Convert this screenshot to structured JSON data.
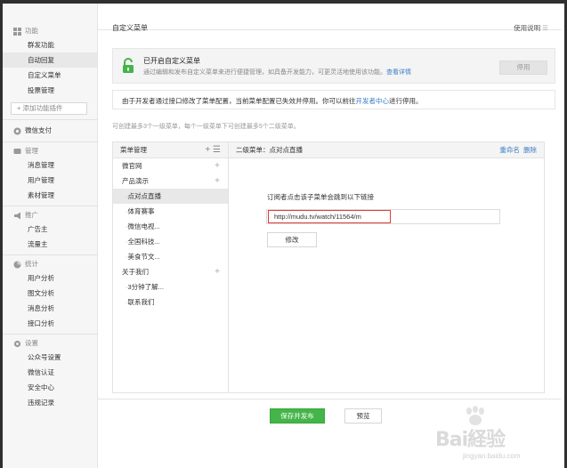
{
  "sidebar": {
    "groups": [
      {
        "title": "功能",
        "icon": "grid-icon",
        "items": [
          {
            "label": "群发功能"
          },
          {
            "label": "自动回复",
            "active": true
          },
          {
            "label": "自定义菜单"
          },
          {
            "label": "投票管理"
          }
        ]
      },
      {
        "title": "微信支付",
        "icon": "circle-icon",
        "items": []
      },
      {
        "title": "管理",
        "icon": "chat-icon",
        "items": [
          {
            "label": "消息管理"
          },
          {
            "label": "用户管理"
          },
          {
            "label": "素材管理"
          }
        ]
      },
      {
        "title": "推广",
        "icon": "megaphone-icon",
        "items": [
          {
            "label": "广告主"
          },
          {
            "label": "流量主"
          }
        ]
      },
      {
        "title": "统计",
        "icon": "pie-icon",
        "items": [
          {
            "label": "用户分析"
          },
          {
            "label": "图文分析"
          },
          {
            "label": "消息分析"
          },
          {
            "label": "接口分析"
          }
        ]
      },
      {
        "title": "设置",
        "icon": "gear-icon",
        "items": [
          {
            "label": "公众号设置"
          },
          {
            "label": "微信认证"
          },
          {
            "label": "安全中心"
          },
          {
            "label": "违规记录"
          }
        ]
      }
    ],
    "add_plugin": "+ 添加功能插件"
  },
  "page": {
    "title": "自定义菜单",
    "help": "使用说明"
  },
  "notice": {
    "title": "已开启自定义菜单",
    "desc": "通过编辑和发布自定义菜单来进行便捷管理，如具备开发能力，可更灵活地使用该功能。",
    "link": "查看详情",
    "disable_label": "停用"
  },
  "warning": {
    "text_before": "由于开发者通过接口修改了菜单配置，当前菜单配置已失效并停用。你可以前往",
    "link": "开发者中心",
    "text_after": "进行停用。"
  },
  "hint": "可创建最多3个一级菜单，每个一级菜单下可创建最多5个二级菜单。",
  "menu_panel": {
    "header": "菜单管理",
    "rows": [
      {
        "label": "微官网",
        "level": 1,
        "plus": true
      },
      {
        "label": "产品演示",
        "level": 1,
        "plus": true
      },
      {
        "label": "点对点直播",
        "level": 2,
        "active": true
      },
      {
        "label": "体育赛事",
        "level": 2
      },
      {
        "label": "微信电视...",
        "level": 2
      },
      {
        "label": "全国科技...",
        "level": 2
      },
      {
        "label": "美食节文...",
        "level": 2
      },
      {
        "label": "关于我们",
        "level": 1,
        "plus": true
      },
      {
        "label": "3分钟了解...",
        "level": 2
      },
      {
        "label": "联系我们",
        "level": 2
      }
    ]
  },
  "detail_panel": {
    "header": "二级菜单：点对点直播",
    "rename": "重命名",
    "delete": "删除",
    "label": "订阅者点击该子菜单会跳到以下链接",
    "url": "http://mudu.tv/watch/11564/m",
    "edit_label": "修改"
  },
  "actions": {
    "save_publish": "保存并发布",
    "preview": "预览"
  },
  "watermark": {
    "brand": "Bai経验",
    "url": "jingyan.baidu.com"
  },
  "colors": {
    "accent_green": "#44b549",
    "link_blue": "#3b7ec2",
    "highlight_red": "#e23b3b"
  }
}
